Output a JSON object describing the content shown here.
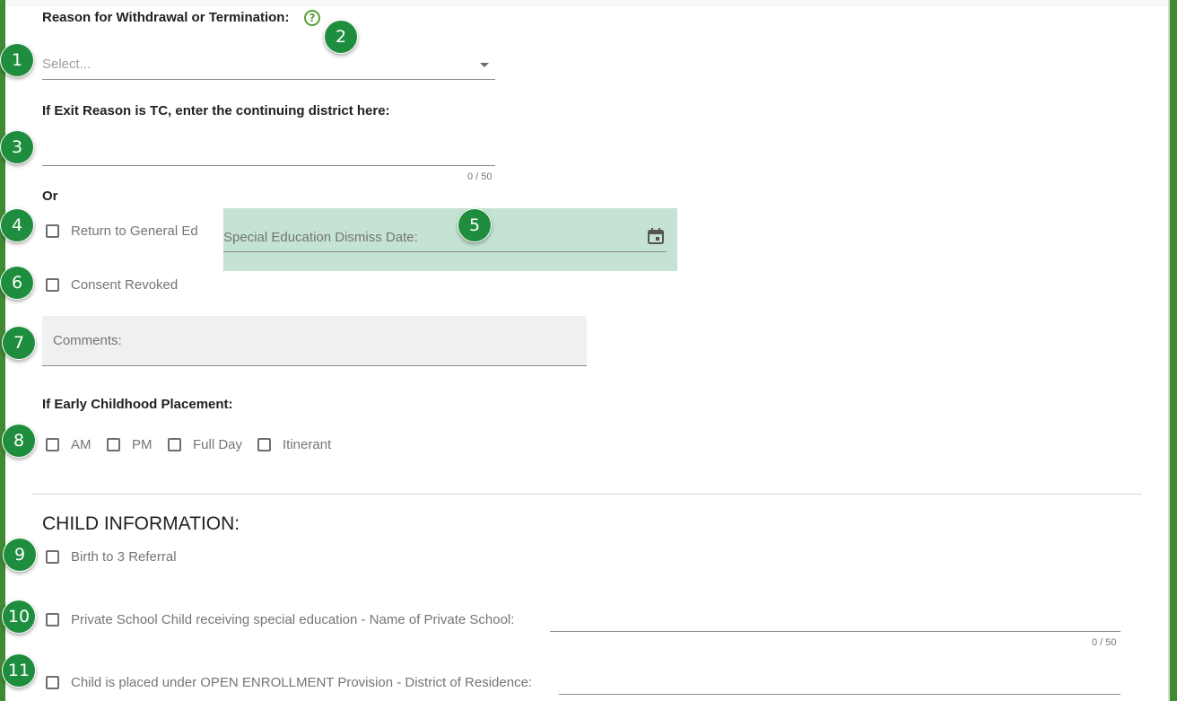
{
  "withdrawal": {
    "label": "Reason for Withdrawal or Termination:",
    "help_icon": "help-circle-icon",
    "select_placeholder": "Select..."
  },
  "continuing_district": {
    "label": "If Exit Reason is TC, enter the continuing district here:",
    "value": "",
    "counter": "0 / 50"
  },
  "or_label": "Or",
  "return_general_ed": {
    "label": "Return to General Ed",
    "checked": false
  },
  "dismiss_date": {
    "placeholder": "Special Education Dismiss Date:",
    "icon": "calendar-icon"
  },
  "consent_revoked": {
    "label": "Consent Revoked",
    "checked": false
  },
  "comments": {
    "placeholder": "Comments:"
  },
  "early_childhood": {
    "label": "If Early Childhood Placement:",
    "options": [
      "AM",
      "PM",
      "Full Day",
      "Itinerant"
    ]
  },
  "child_info": {
    "title": "CHILD INFORMATION:",
    "birth_to_3": "Birth to 3 Referral",
    "private_school": "Private School Child receiving special education - Name of Private School:",
    "private_school_counter": "0 / 50",
    "open_enrollment": "Child is placed under OPEN ENROLLMENT Provision - District of Residence:"
  },
  "badges": [
    "1",
    "2",
    "3",
    "4",
    "5",
    "6",
    "7",
    "8",
    "9",
    "10",
    "11"
  ],
  "colors": {
    "accent_green": "#1e8e3e",
    "border_green": "#3f8a32",
    "date_highlight": "#c5e3d3"
  }
}
